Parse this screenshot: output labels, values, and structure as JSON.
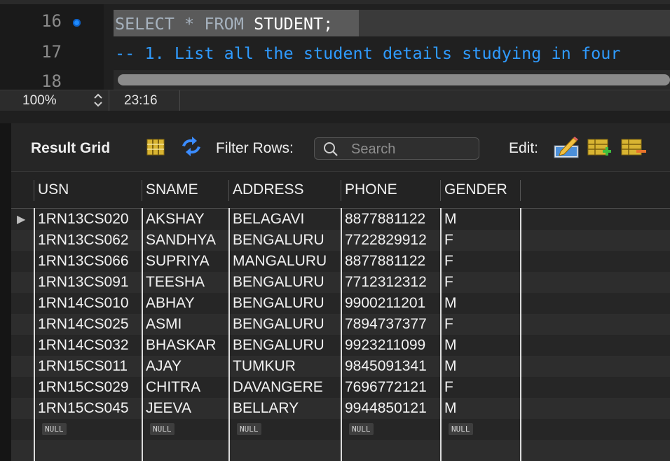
{
  "editor": {
    "line_numbers": [
      "16",
      "17",
      "18"
    ],
    "line16_keywords": [
      "SELECT",
      "*",
      "FROM"
    ],
    "line16_table": "STUDENT;",
    "line17": "-- 1. List all the student details studying in four"
  },
  "statusbar": {
    "zoom": "100%",
    "cursor": "23:16"
  },
  "toolbar": {
    "result_grid": "Result Grid",
    "filter_rows": "Filter Rows:",
    "search_placeholder": "Search",
    "edit": "Edit:"
  },
  "grid": {
    "columns": [
      "USN",
      "SNAME",
      "ADDRESS",
      "PHONE",
      "GENDER"
    ],
    "rows": [
      [
        "1RN13CS020",
        "AKSHAY",
        "BELAGAVI",
        "8877881122",
        "M"
      ],
      [
        "1RN13CS062",
        "SANDHYA",
        "BENGALURU",
        "7722829912",
        "F"
      ],
      [
        "1RN13CS066",
        "SUPRIYA",
        "MANGALURU",
        "8877881122",
        "F"
      ],
      [
        "1RN13CS091",
        "TEESHA",
        "BENGALURU",
        "7712312312",
        "F"
      ],
      [
        "1RN14CS010",
        "ABHAY",
        "BENGALURU",
        "9900211201",
        "M"
      ],
      [
        "1RN14CS025",
        "ASMI",
        "BENGALURU",
        "7894737377",
        "F"
      ],
      [
        "1RN14CS032",
        "BHASKAR",
        "BENGALURU",
        "9923211099",
        "M"
      ],
      [
        "1RN15CS011",
        "AJAY",
        "TUMKUR",
        "9845091341",
        "M"
      ],
      [
        "1RN15CS029",
        "CHITRA",
        "DAVANGERE",
        "7696772121",
        "F"
      ],
      [
        "1RN15CS045",
        "JEEVA",
        "BELLARY",
        "9944850121",
        "M"
      ]
    ],
    "null_label": "NULL"
  },
  "colors": {
    "accent_blue": "#2f9bff",
    "selection": "#5a5a5a",
    "grid_lines": "#dcdcdc"
  }
}
